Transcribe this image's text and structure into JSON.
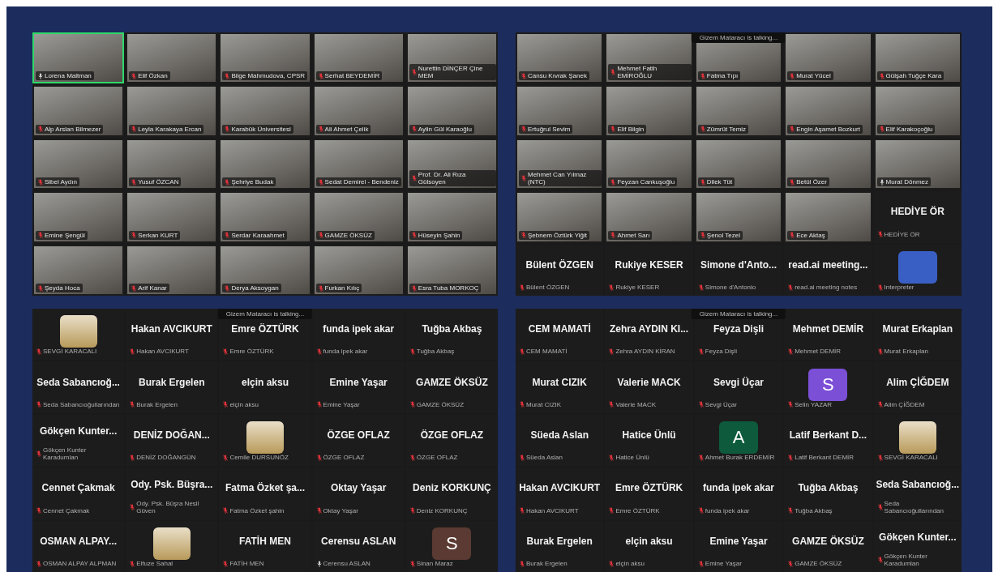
{
  "panels": [
    {
      "tiles": [
        {
          "kind": "video",
          "label": "Lorena Maltman",
          "muted": false,
          "active": true
        },
        {
          "kind": "video",
          "label": "Elif Özkan",
          "muted": true,
          "active": false
        },
        {
          "kind": "video",
          "label": "Bilge Mahmudova, CPSR",
          "muted": true,
          "active": false
        },
        {
          "kind": "video",
          "label": "Serhat BEYDEMİR",
          "muted": true,
          "active": false
        },
        {
          "kind": "video",
          "label": "Nurettin DİNÇER Çine MEM",
          "muted": true,
          "active": false
        },
        {
          "kind": "video",
          "label": "Alp Arslan Bilmezer",
          "muted": true,
          "active": false
        },
        {
          "kind": "video",
          "label": "Leyla Karakaya Ercan",
          "muted": true,
          "active": false
        },
        {
          "kind": "video",
          "label": "Karabük Üniversitesi",
          "muted": true,
          "active": false
        },
        {
          "kind": "video",
          "label": "Ali Ahmet Çelik",
          "muted": true,
          "active": false
        },
        {
          "kind": "video",
          "label": "Aylin Gül Karaoğlu",
          "muted": true,
          "active": false
        },
        {
          "kind": "video",
          "label": "Sibel Aydın",
          "muted": true,
          "active": false
        },
        {
          "kind": "video",
          "label": "Yusuf ÖZCAN",
          "muted": true,
          "active": false
        },
        {
          "kind": "video",
          "label": "Şehriye Budak",
          "muted": true,
          "active": false
        },
        {
          "kind": "video",
          "label": "Sedat Demirel - Bendeniz",
          "muted": true,
          "active": false
        },
        {
          "kind": "video",
          "label": "Prof. Dr. Ali Rıza Gülsoyen",
          "muted": true,
          "active": false
        },
        {
          "kind": "video",
          "label": "Emine Şengül",
          "muted": true,
          "active": false
        },
        {
          "kind": "video",
          "label": "Serkan KURT",
          "muted": true,
          "active": false
        },
        {
          "kind": "video",
          "label": "Serdar Karaahmet",
          "muted": true,
          "active": false
        },
        {
          "kind": "video",
          "label": "GAMZE ÖKSÜZ",
          "muted": true,
          "active": false
        },
        {
          "kind": "video",
          "label": "Hüseyin Şahin",
          "muted": true,
          "active": false
        },
        {
          "kind": "video",
          "label": "Şeyda Hoca",
          "muted": true,
          "active": false
        },
        {
          "kind": "video",
          "label": "Arif Kanar",
          "muted": true,
          "active": false
        },
        {
          "kind": "video",
          "label": "Derya Aksoygan",
          "muted": true,
          "active": false
        },
        {
          "kind": "video",
          "label": "Furkan Kılıç",
          "muted": true,
          "active": false
        },
        {
          "kind": "video",
          "label": "Esra Tuba MORKOÇ",
          "muted": true,
          "active": false
        }
      ]
    },
    {
      "talking": "Gizem Mataracı is talking...",
      "tiles": [
        {
          "kind": "video",
          "label": "Cansu Kıvrak Şanek",
          "muted": true,
          "active": false
        },
        {
          "kind": "video",
          "label": "Mehmet Fatih EMİROĞLU",
          "muted": true,
          "active": false
        },
        {
          "kind": "video",
          "label": "Fatma Tıpı",
          "muted": true,
          "active": false
        },
        {
          "kind": "video",
          "label": "Murat Yücel",
          "muted": true,
          "active": false
        },
        {
          "kind": "video",
          "label": "Gülşah Tuğçe Kara",
          "muted": true,
          "active": false
        },
        {
          "kind": "video",
          "label": "Ertuğrul Sevim",
          "muted": true,
          "active": false
        },
        {
          "kind": "video",
          "label": "Elif Bilgin",
          "muted": true,
          "active": false
        },
        {
          "kind": "video",
          "label": "Zümrüt Temiz",
          "muted": true,
          "active": false
        },
        {
          "kind": "video",
          "label": "Engin Aşamet Bozkurt",
          "muted": true,
          "active": false
        },
        {
          "kind": "video",
          "label": "Elif Karakoçoğlu",
          "muted": true,
          "active": false
        },
        {
          "kind": "video",
          "label": "Mehmet Can Yılmaz (NTC)",
          "muted": true,
          "active": false
        },
        {
          "kind": "video",
          "label": "Feyzan Cankuşoğlu",
          "muted": true,
          "active": false
        },
        {
          "kind": "video",
          "label": "Dilek Tüt",
          "muted": true,
          "active": false
        },
        {
          "kind": "video",
          "label": "Betül Özer",
          "muted": true,
          "active": false
        },
        {
          "kind": "video",
          "label": "Murat Dönmez",
          "muted": false,
          "active": false
        },
        {
          "kind": "video",
          "label": "Şebnem Öztürk Yiğit",
          "muted": true,
          "active": false
        },
        {
          "kind": "video",
          "label": "Ahmet Sarı",
          "muted": true,
          "active": false
        },
        {
          "kind": "video",
          "label": "Şenol Tezel",
          "muted": true,
          "active": false
        },
        {
          "kind": "video",
          "label": "Ece Aktaş",
          "muted": true,
          "active": false
        },
        {
          "kind": "name",
          "name": "HEDİYE ÖR",
          "label": "HEDİYE ÖR",
          "muted": true,
          "active": false
        },
        {
          "kind": "name",
          "name": "Bülent ÖZGEN",
          "label": "Bülent ÖZGEN",
          "muted": true,
          "active": false
        },
        {
          "kind": "name",
          "name": "Rukiye KESER",
          "label": "Rukiye KESER",
          "muted": true,
          "active": false
        },
        {
          "kind": "name",
          "name": "Simone d'Anto...",
          "label": "Simone d'Antonio",
          "muted": true,
          "active": false
        },
        {
          "kind": "name",
          "name": "read.ai meeting...",
          "label": "read.ai meeting notes",
          "muted": true,
          "active": false
        },
        {
          "kind": "avatar",
          "color": "#3a5fc4",
          "label": "Interpreter",
          "muted": true,
          "active": false
        }
      ]
    },
    {
      "talking": "Gizem Mataracı is talking...",
      "tiles": [
        {
          "kind": "picture",
          "label": "SEVGİ KARACALI",
          "muted": true,
          "active": false
        },
        {
          "kind": "name",
          "name": "Hakan AVCIKURT",
          "label": "Hakan AVCIKURT",
          "muted": true,
          "active": false
        },
        {
          "kind": "name",
          "name": "Emre ÖZTÜRK",
          "label": "Emre ÖZTÜRK",
          "muted": true,
          "active": false
        },
        {
          "kind": "name",
          "name": "funda ipek akar",
          "label": "funda ipek akar",
          "muted": true,
          "active": false
        },
        {
          "kind": "name",
          "name": "Tuğba Akbaş",
          "label": "Tuğba Akbaş",
          "muted": true,
          "active": false
        },
        {
          "kind": "name",
          "name": "Seda Sabancıoğ...",
          "label": "Seda Sabancıoğullarından",
          "muted": true,
          "active": false
        },
        {
          "kind": "name",
          "name": "Burak Ergelen",
          "label": "Burak Ergelen",
          "muted": true,
          "active": false
        },
        {
          "kind": "name",
          "name": "elçin aksu",
          "label": "elçin aksu",
          "muted": true,
          "active": false
        },
        {
          "kind": "name",
          "name": "Emine Yaşar",
          "label": "Emine Yaşar",
          "muted": true,
          "active": false
        },
        {
          "kind": "name",
          "name": "GAMZE ÖKSÜZ",
          "label": "GAMZE ÖKSÜZ",
          "muted": true,
          "active": false
        },
        {
          "kind": "name",
          "name": "Gökçen Kunter...",
          "label": "Gökçen Kunter Karadumlan",
          "muted": true,
          "active": false
        },
        {
          "kind": "name",
          "name": "DENİZ DOĞAN...",
          "label": "DENİZ DOĞANGÜN",
          "muted": true,
          "active": false
        },
        {
          "kind": "picture",
          "label": "Cemile DURSUNÖZ",
          "muted": true,
          "active": false
        },
        {
          "kind": "name",
          "name": "ÖZGE OFLAZ",
          "label": "ÖZGE OFLAZ",
          "muted": true,
          "active": false
        },
        {
          "kind": "name",
          "name": "ÖZGE OFLAZ",
          "label": "ÖZGE OFLAZ",
          "muted": true,
          "active": false
        },
        {
          "kind": "name",
          "name": "Cennet Çakmak",
          "label": "Cennet Çakmak",
          "muted": true,
          "active": false
        },
        {
          "kind": "name",
          "name": "Ody. Psk. Büşra...",
          "label": "Ody. Psk. Büşra Nesil Güven",
          "muted": true,
          "active": false
        },
        {
          "kind": "name",
          "name": "Fatma Özket şa...",
          "label": "Fatma Özket şahin",
          "muted": true,
          "active": false
        },
        {
          "kind": "name",
          "name": "Oktay Yaşar",
          "label": "Oktay Yaşar",
          "muted": true,
          "active": false
        },
        {
          "kind": "name",
          "name": "Deniz KORKUNÇ",
          "label": "Deniz KORKUNÇ",
          "muted": true,
          "active": false
        },
        {
          "kind": "name",
          "name": "OSMAN ALPAY...",
          "label": "OSMAN ALPAY ALPMAN",
          "muted": true,
          "active": false
        },
        {
          "kind": "picture",
          "label": "Elfuze Sahal",
          "muted": true,
          "active": false
        },
        {
          "kind": "name",
          "name": "FATİH MEN",
          "label": "FATİH MEN",
          "muted": true,
          "active": false
        },
        {
          "kind": "name",
          "name": "Cerensu ASLAN",
          "label": "Cerensu ASLAN",
          "muted": false,
          "active": false
        },
        {
          "kind": "avatar",
          "letter": "S",
          "color": "#5a3a32",
          "label": "Sinan Maraz",
          "muted": true,
          "active": false
        }
      ]
    },
    {
      "talking": "Gizem Mataracı is talking...",
      "tiles": [
        {
          "kind": "name",
          "name": "CEM MAMATİ",
          "label": "CEM MAMATİ",
          "muted": true,
          "active": false
        },
        {
          "kind": "name",
          "name": "Zehra AYDIN KI...",
          "label": "Zehra AYDIN KİRAN",
          "muted": true,
          "active": false
        },
        {
          "kind": "name",
          "name": "Feyza Dişli",
          "label": "Feyza Dişli",
          "muted": true,
          "active": false
        },
        {
          "kind": "name",
          "name": "Mehmet DEMİR",
          "label": "Mehmet DEMİR",
          "muted": true,
          "active": false
        },
        {
          "kind": "name",
          "name": "Murat Erkaplan",
          "label": "Murat Erkaplan",
          "muted": true,
          "active": false
        },
        {
          "kind": "name",
          "name": "Murat CIZIK",
          "label": "Murat CIZIK",
          "muted": true,
          "active": false
        },
        {
          "kind": "name",
          "name": "Valerie MACK",
          "label": "Valerie MACK",
          "muted": true,
          "active": false
        },
        {
          "kind": "name",
          "name": "Sevgi Üçar",
          "label": "Sevgi Üçar",
          "muted": true,
          "active": false
        },
        {
          "kind": "avatar",
          "letter": "S",
          "color": "#7b4fd6",
          "label": "Selin YAZAR",
          "muted": true,
          "active": false
        },
        {
          "kind": "name",
          "name": "Alim ÇİĞDEM",
          "label": "Alim ÇİĞDEM",
          "muted": true,
          "active": false
        },
        {
          "kind": "name",
          "name": "Süeda Aslan",
          "label": "Süeda Aslan",
          "muted": true,
          "active": false
        },
        {
          "kind": "name",
          "name": "Hatice Ünlü",
          "label": "Hatice Ünlü",
          "muted": true,
          "active": false
        },
        {
          "kind": "avatar",
          "letter": "A",
          "color": "#0d5a3c",
          "label": "Ahmet Burak ERDEMİR",
          "muted": true,
          "active": false
        },
        {
          "kind": "name",
          "name": "Latif Berkant D...",
          "label": "Latif Berkant DEMİR",
          "muted": true,
          "active": false
        },
        {
          "kind": "picture",
          "label": "SEVGİ KARACALI",
          "muted": true,
          "active": false
        },
        {
          "kind": "name",
          "name": "Hakan AVCIKURT",
          "label": "Hakan AVCIKURT",
          "muted": true,
          "active": false
        },
        {
          "kind": "name",
          "name": "Emre ÖZTÜRK",
          "label": "Emre ÖZTÜRK",
          "muted": true,
          "active": false
        },
        {
          "kind": "name",
          "name": "funda ipek akar",
          "label": "funda ipek akar",
          "muted": true,
          "active": false
        },
        {
          "kind": "name",
          "name": "Tuğba Akbaş",
          "label": "Tuğba Akbaş",
          "muted": true,
          "active": false
        },
        {
          "kind": "name",
          "name": "Seda Sabancıoğ...",
          "label": "Seda Sabancıoğullarından",
          "muted": true,
          "active": false
        },
        {
          "kind": "name",
          "name": "Burak Ergelen",
          "label": "Burak Ergelen",
          "muted": true,
          "active": false
        },
        {
          "kind": "name",
          "name": "elçin aksu",
          "label": "elçin aksu",
          "muted": true,
          "active": false
        },
        {
          "kind": "name",
          "name": "Emine Yaşar",
          "label": "Emine Yaşar",
          "muted": true,
          "active": false
        },
        {
          "kind": "name",
          "name": "GAMZE ÖKSÜZ",
          "label": "GAMZE ÖKSÜZ",
          "muted": true,
          "active": false
        },
        {
          "kind": "name",
          "name": "Gökçen Kunter...",
          "label": "Gökçen Kunter Karadumlan",
          "muted": true,
          "active": false
        }
      ]
    }
  ]
}
